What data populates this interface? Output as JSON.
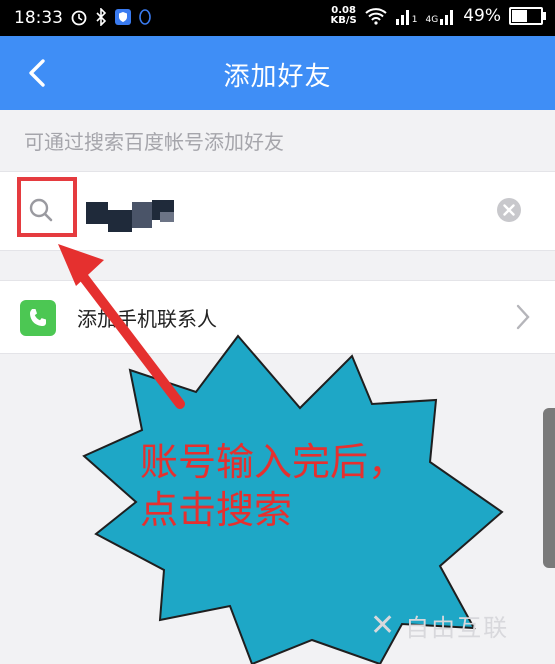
{
  "status_bar": {
    "time": "18:33",
    "net_speed_value": "0.08",
    "net_speed_unit": "KB/S",
    "signal_1_label": "1",
    "signal_2_label": "4G",
    "battery_percent": "49%",
    "battery_level": 0.49,
    "icons": [
      "alarm-icon",
      "bluetooth-icon",
      "shield-app-icon",
      "qq-icon",
      "wifi-icon",
      "signal-icon",
      "battery-icon"
    ]
  },
  "header": {
    "title": "添加好友",
    "background": "#3f8ef6"
  },
  "hint": "可通过搜索百度帐号添加好友",
  "search": {
    "value": "",
    "placeholder": ""
  },
  "contacts": {
    "label": "添加手机联系人",
    "icon": "phone-icon",
    "icon_color": "#4cc753"
  },
  "annotation": {
    "line1": "账号输入完后，",
    "line2": "点击搜索",
    "color": "#e5302f",
    "bubble_color": "#1ea7c6"
  },
  "watermark": {
    "text": "自由互联"
  }
}
